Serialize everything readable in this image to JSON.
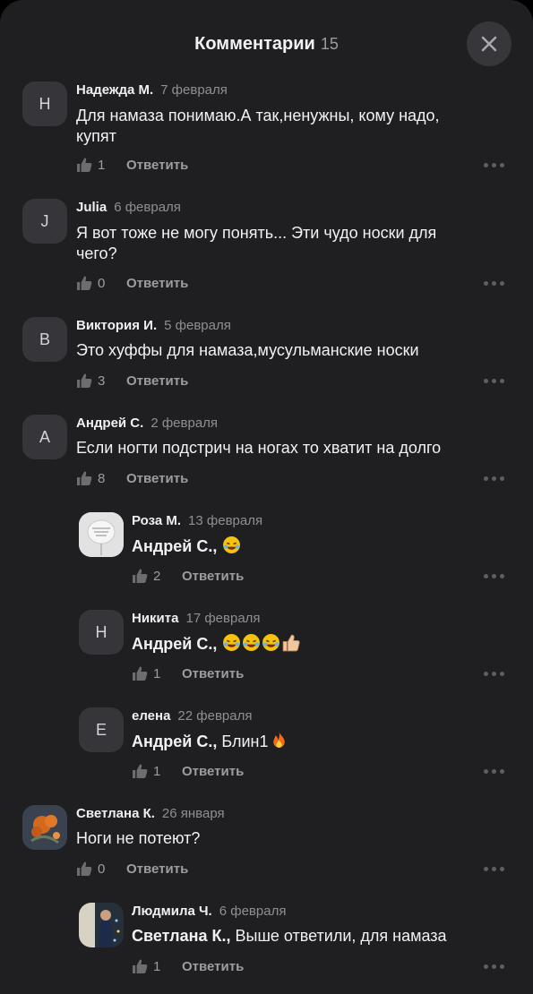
{
  "header": {
    "title": "Комментарии",
    "count": "15"
  },
  "comments": [
    {
      "author": "Надежда М.",
      "date": "7 февраля",
      "avatar_letter": "Н",
      "line1": "Для намаза понимаю.А так,ненужны, кому надо,",
      "line2": "купят",
      "likes": "1",
      "reply": "Ответить"
    },
    {
      "author": "Julia",
      "date": "6 февраля",
      "avatar_letter": "J",
      "line1": "Я вот тоже не могу понять... Эти чудо носки для",
      "line2": "чего?",
      "likes": "0",
      "reply": "Ответить"
    },
    {
      "author": "Виктория И.",
      "date": "5 февраля",
      "avatar_letter": "В",
      "line1": "Это хуффы для намаза,мусульманские носки",
      "likes": "3",
      "reply": "Ответить"
    },
    {
      "author": "Андрей С.",
      "date": "2 февраля",
      "avatar_letter": "А",
      "line1": "Если ногти подстрич  на ногах то хватит на долго",
      "likes": "8",
      "reply": "Ответить"
    },
    {
      "author": "Роза М.",
      "date": "13 февраля",
      "mention": "Андрей С.,",
      "text": "",
      "emojis": [
        "rofl"
      ],
      "likes": "2",
      "reply": "Ответить"
    },
    {
      "author": "Никита",
      "date": "17 февраля",
      "avatar_letter": "Н",
      "mention": "Андрей С.,",
      "text": "",
      "emojis": [
        "rofl",
        "rofl",
        "rofl",
        "thumbs-up"
      ],
      "likes": "1",
      "reply": "Ответить"
    },
    {
      "author": "елена",
      "date": "22 февраля",
      "avatar_letter": "Е",
      "mention": "Андрей С.,",
      "text": "Блин1",
      "emojis": [
        "fire"
      ],
      "likes": "1",
      "reply": "Ответить"
    },
    {
      "author": "Светлана К.",
      "date": "26 января",
      "line1": "Ноги не потеют?",
      "likes": "0",
      "reply": "Ответить"
    },
    {
      "author": "Людмила Ч.",
      "date": "6 февраля",
      "mention": "Светлана К.,",
      "text": "Выше ответили, для намаза",
      "likes": "1",
      "reply": "Ответить"
    }
  ]
}
